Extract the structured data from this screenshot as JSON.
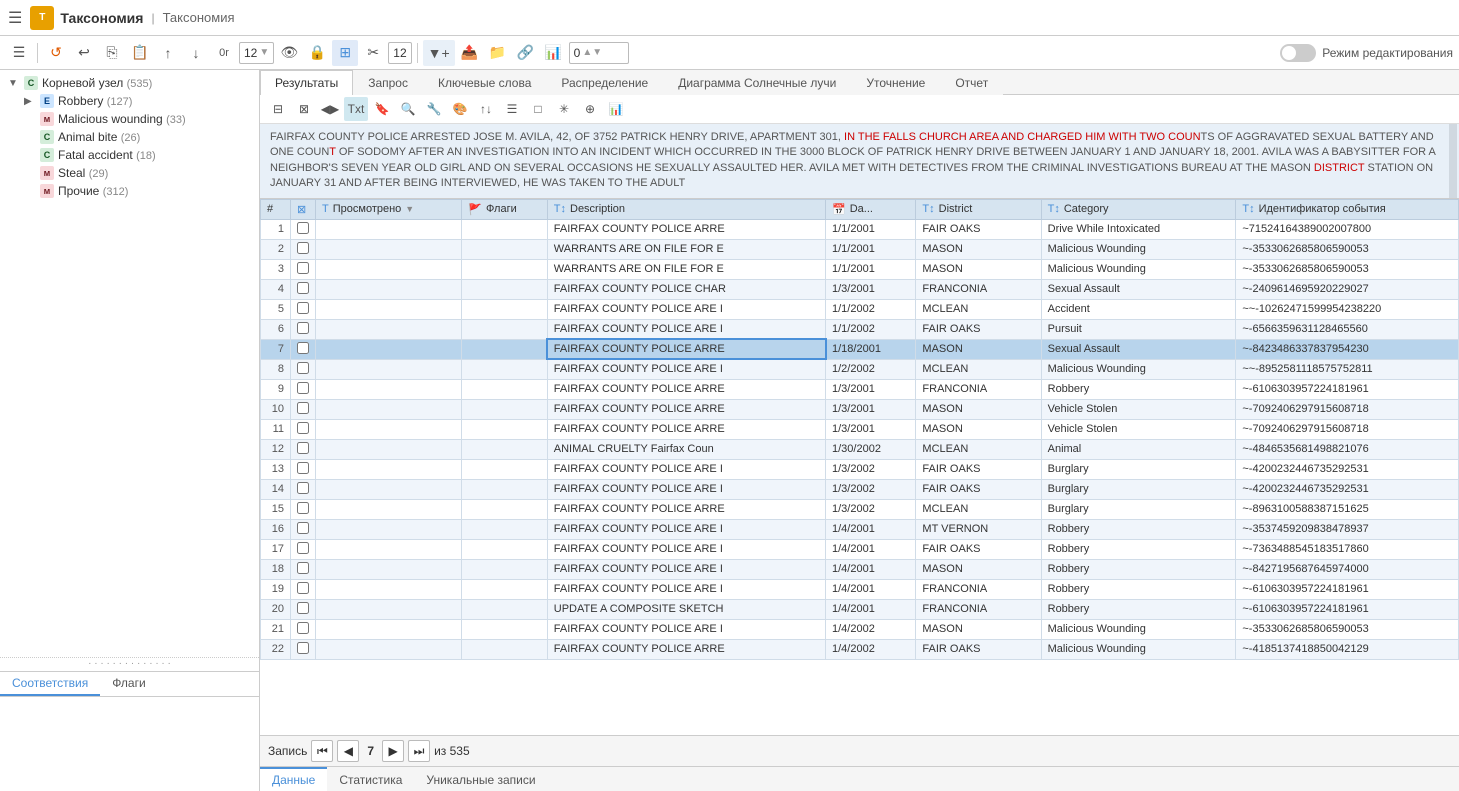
{
  "app": {
    "title": "Таксономия",
    "subtitle": "Таксономия",
    "menu_icon": "☰"
  },
  "toolbar": {
    "editing_mode": "Режим редактирования",
    "counter_value": "12",
    "counter_value2": "12",
    "counter_value3": "0"
  },
  "tree": {
    "root_label": "Корневой узел",
    "root_count": "(535)",
    "items": [
      {
        "type": "E",
        "label": "Robbery",
        "count": "(127)",
        "expanded": true
      },
      {
        "type": "M",
        "label": "Malicious wounding",
        "count": "(33)",
        "expanded": false
      },
      {
        "type": "C",
        "label": "Animal bite",
        "count": "(26)",
        "expanded": false
      },
      {
        "type": "C",
        "label": "Fatal accident",
        "count": "(18)",
        "expanded": false
      },
      {
        "type": "M",
        "label": "Steal",
        "count": "(29)",
        "expanded": false
      },
      {
        "type": "M",
        "label": "Прочие",
        "count": "(312)",
        "expanded": false
      }
    ]
  },
  "left_tabs": {
    "tab1": "Соответствия",
    "tab2": "Флаги"
  },
  "main_tabs": [
    "Результаты",
    "Запрос",
    "Ключевые слова",
    "Распределение",
    "Диаграмма Солнечные лучи",
    "Уточнение",
    "Отчет"
  ],
  "text_preview": "FAIRFAX COUNTY POLICE ARRESTED JOSE M. AVILA, 42, OF 3752 PATRICK HENRY DRIVE, APARTMENT 301, IN THE FALLS CHURCH AREA AND CHARGED HIM WITH TWO COUNTS OF AGGRAVATED SEXUAL BATTERY AND ONE COUNT OF SODOMY AFTER AN INVESTIGATION INTO AN INCIDENT WHICH OCCURRED IN THE 3000 BLOCK OF PATRICK HENRY DRIVE BETWEEN JANUARY 1 AND JANUARY 18, 2001. AVILA WAS A BABYSITTER FOR A NEIGHBOR'S SEVEN YEAR OLD GIRL AND ON SEVERAL OCCASIONS HE SEXUALLY ASSAULTED HER. AVILA MET WITH DETECTIVES FROM THE CRIMINAL INVESTIGATIONS BUREAU AT THE MASON DISTRICT STATION ON JANUARY 31 AND AFTER BEING INTERVIEWED, HE WAS TAKEN TO THE ADULT",
  "table": {
    "columns": [
      "#",
      "",
      "Просмотрено",
      "Флаги",
      "Description",
      "Da...",
      "District",
      "Category",
      "Идентификатор события"
    ],
    "rows": [
      {
        "num": 1,
        "desc": "FAIRFAX COUNTY POLICE ARRE",
        "date": "1/1/2001",
        "district": "FAIR OAKS",
        "category": "Drive While Intoxicated",
        "id": "~71524164389002007800"
      },
      {
        "num": 2,
        "desc": "WARRANTS ARE ON FILE FOR E",
        "date": "1/1/2001",
        "district": "MASON",
        "category": "Malicious Wounding",
        "id": "~-3533062685806590053"
      },
      {
        "num": 3,
        "desc": "WARRANTS ARE ON FILE FOR E",
        "date": "1/1/2001",
        "district": "MASON",
        "category": "Malicious Wounding",
        "id": "~-3533062685806590053"
      },
      {
        "num": 4,
        "desc": "FAIRFAX COUNTY POLICE CHAR",
        "date": "1/3/2001",
        "district": "FRANCONIA",
        "category": "Sexual Assault",
        "id": "~-2409614695920229027"
      },
      {
        "num": 5,
        "desc": "FAIRFAX COUNTY POLICE ARE I",
        "date": "1/1/2002",
        "district": "MCLEAN",
        "category": "Accident",
        "id": "~~-10262471599954238220"
      },
      {
        "num": 6,
        "desc": "FAIRFAX COUNTY POLICE ARE I",
        "date": "1/1/2002",
        "district": "FAIR OAKS",
        "category": "Pursuit",
        "id": "~-6566359631128465560"
      },
      {
        "num": 7,
        "desc": "FAIRFAX COUNTY POLICE ARRE",
        "date": "1/18/2001",
        "district": "MASON",
        "category": "Sexual Assault",
        "id": "~-8423486337837954230",
        "highlight": true
      },
      {
        "num": 8,
        "desc": "FAIRFAX COUNTY POLICE ARE I",
        "date": "1/2/2002",
        "district": "MCLEAN",
        "category": "Malicious Wounding",
        "id": "~~-8952581118575752811"
      },
      {
        "num": 9,
        "desc": "FAIRFAX COUNTY POLICE ARRE",
        "date": "1/3/2001",
        "district": "FRANCONIA",
        "category": "Robbery",
        "id": "~-6106303957224181961"
      },
      {
        "num": 10,
        "desc": "FAIRFAX COUNTY POLICE ARRE",
        "date": "1/3/2001",
        "district": "MASON",
        "category": "Vehicle Stolen",
        "id": "~-7092406297915608718"
      },
      {
        "num": 11,
        "desc": "FAIRFAX COUNTY POLICE ARRE",
        "date": "1/3/2001",
        "district": "MASON",
        "category": "Vehicle Stolen",
        "id": "~-7092406297915608718"
      },
      {
        "num": 12,
        "desc": "ANIMAL CRUELTY Fairfax Coun",
        "date": "1/30/2002",
        "district": "MCLEAN",
        "category": "Animal",
        "id": "~-4846535681498821076"
      },
      {
        "num": 13,
        "desc": "FAIRFAX COUNTY POLICE ARE I",
        "date": "1/3/2002",
        "district": "FAIR OAKS",
        "category": "Burglary",
        "id": "~-4200232446735292531"
      },
      {
        "num": 14,
        "desc": "FAIRFAX COUNTY POLICE ARE I",
        "date": "1/3/2002",
        "district": "FAIR OAKS",
        "category": "Burglary",
        "id": "~-4200232446735292531"
      },
      {
        "num": 15,
        "desc": "FAIRFAX COUNTY POLICE ARRE",
        "date": "1/3/2002",
        "district": "MCLEAN",
        "category": "Burglary",
        "id": "~-8963100588387151625"
      },
      {
        "num": 16,
        "desc": "FAIRFAX COUNTY POLICE ARE I",
        "date": "1/4/2001",
        "district": "MT VERNON",
        "category": "Robbery",
        "id": "~-3537459209838478937"
      },
      {
        "num": 17,
        "desc": "FAIRFAX COUNTY POLICE ARE I",
        "date": "1/4/2001",
        "district": "FAIR OAKS",
        "category": "Robbery",
        "id": "~-7363488545183517860"
      },
      {
        "num": 18,
        "desc": "FAIRFAX COUNTY POLICE ARE I",
        "date": "1/4/2001",
        "district": "MASON",
        "category": "Robbery",
        "id": "~-8427195687645974000"
      },
      {
        "num": 19,
        "desc": "FAIRFAX COUNTY POLICE ARE I",
        "date": "1/4/2001",
        "district": "FRANCONIA",
        "category": "Robbery",
        "id": "~-6106303957224181961"
      },
      {
        "num": 20,
        "desc": "UPDATE A COMPOSITE SKETCH",
        "date": "1/4/2001",
        "district": "FRANCONIA",
        "category": "Robbery",
        "id": "~-6106303957224181961"
      },
      {
        "num": 21,
        "desc": "FAIRFAX COUNTY POLICE ARE I",
        "date": "1/4/2002",
        "district": "MASON",
        "category": "Malicious Wounding",
        "id": "~-3533062685806590053"
      },
      {
        "num": 22,
        "desc": "FAIRFAX COUNTY POLICE ARRE",
        "date": "1/4/2002",
        "district": "FAIR OAKS",
        "category": "Malicious Wounding",
        "id": "~-4185137418850042129"
      }
    ]
  },
  "pager": {
    "label": "Запись",
    "current": "7",
    "total": "из 535"
  },
  "bottom_tabs": [
    "Данные",
    "Статистика",
    "Уникальные записи"
  ]
}
